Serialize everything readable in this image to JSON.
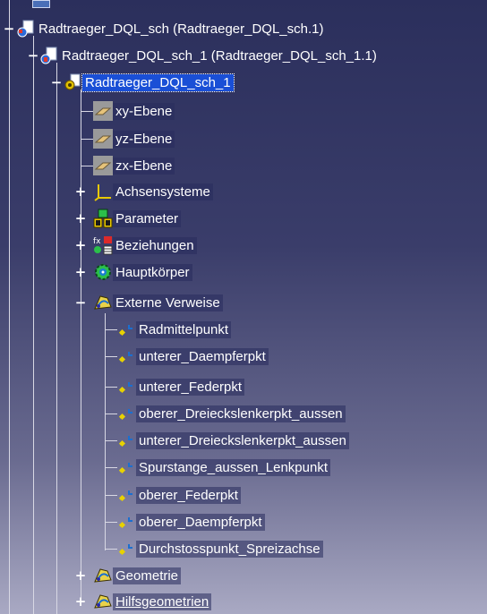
{
  "tree": {
    "root": {
      "label": "Radtraeger_DQL_sch (Radtraeger_DQL_sch.1)",
      "icon": "product-icon"
    },
    "product": {
      "label": "Radtraeger_DQL_sch_1 (Radtraeger_DQL_sch_1.1)",
      "icon": "product-icon"
    },
    "part": {
      "label": "Radtraeger_DQL_sch_1",
      "icon": "part-gear-icon",
      "selected": true
    },
    "planes": [
      {
        "label": "xy-Ebene",
        "icon": "plane-icon"
      },
      {
        "label": "yz-Ebene",
        "icon": "plane-icon"
      },
      {
        "label": "zx-Ebene",
        "icon": "plane-icon"
      }
    ],
    "groups": [
      {
        "label": "Achsensysteme",
        "icon": "axis-system-icon",
        "expander": "+"
      },
      {
        "label": "Parameter",
        "icon": "parameter-icon",
        "expander": "+"
      },
      {
        "label": "Beziehungen",
        "icon": "relations-icon",
        "expander": "+"
      },
      {
        "label": "Hauptkörper",
        "icon": "body-gear-icon",
        "expander": "+"
      }
    ],
    "external": {
      "label": "Externe Verweise",
      "icon": "geometrical-set-icon",
      "expander": "−"
    },
    "points": [
      "Radmittelpunkt",
      "unterer_Daempferpkt",
      "unterer_Federpkt",
      "oberer_Dreieckslenkerpkt_aussen",
      "unterer_Dreieckslenkerpkt_aussen",
      "Spurstange_aussen_Lenkpunkt",
      "oberer_Federpkt",
      "oberer_Daempferpkt",
      "Durchstosspunkt_Spreizachse"
    ],
    "tail_groups": [
      {
        "label": "Geometrie",
        "icon": "geometrical-set-icon",
        "expander": "+"
      },
      {
        "label": "Hilfsgeometrien",
        "icon": "geometrical-set-icon",
        "expander": "+"
      }
    ]
  },
  "colors": {
    "selected": "#1a4fd6",
    "line": "#d8d8e4",
    "point_yellow": "#e8d200",
    "point_blue": "#1b6fd0"
  }
}
